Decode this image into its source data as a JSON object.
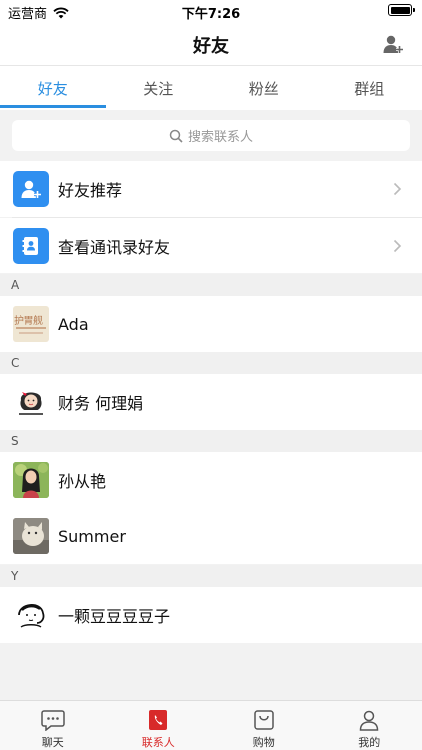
{
  "status_bar": {
    "carrier": "运营商",
    "time": "下午7:26"
  },
  "nav": {
    "title": "好友"
  },
  "tabs": [
    {
      "label": "好友",
      "active": true
    },
    {
      "label": "关注",
      "active": false
    },
    {
      "label": "粉丝",
      "active": false
    },
    {
      "label": "群组",
      "active": false
    }
  ],
  "search": {
    "placeholder": "搜索联系人"
  },
  "features": [
    {
      "label": "好友推荐",
      "icon": "add-friend-icon"
    },
    {
      "label": "查看通讯录好友",
      "icon": "contacts-book-icon"
    }
  ],
  "sections": [
    {
      "letter": "A",
      "contacts": [
        {
          "name": "Ada",
          "avatar": "avatar-ada",
          "avatar_text": "护胃舰"
        }
      ]
    },
    {
      "letter": "C",
      "contacts": [
        {
          "name": "财务 何理娟",
          "avatar": "avatar-cartoon-girl"
        }
      ]
    },
    {
      "letter": "S",
      "contacts": [
        {
          "name": "孙从艳",
          "avatar": "avatar-photo-woman"
        },
        {
          "name": "Summer",
          "avatar": "avatar-cat"
        }
      ]
    },
    {
      "letter": "Y",
      "contacts": [
        {
          "name": "一颗豆豆豆豆子",
          "avatar": "avatar-sketch"
        }
      ]
    }
  ],
  "tabbar": [
    {
      "label": "聊天",
      "icon": "chat-bubble-icon",
      "active": false
    },
    {
      "label": "联系人",
      "icon": "contacts-phone-icon",
      "active": true
    },
    {
      "label": "购物",
      "icon": "shopping-bag-icon",
      "active": false
    },
    {
      "label": "我的",
      "icon": "person-icon",
      "active": false
    }
  ],
  "colors": {
    "accent": "#2a8ee0",
    "feature_icon_bg": "#2f8ff0",
    "tab_active_red": "#d82a2a"
  }
}
